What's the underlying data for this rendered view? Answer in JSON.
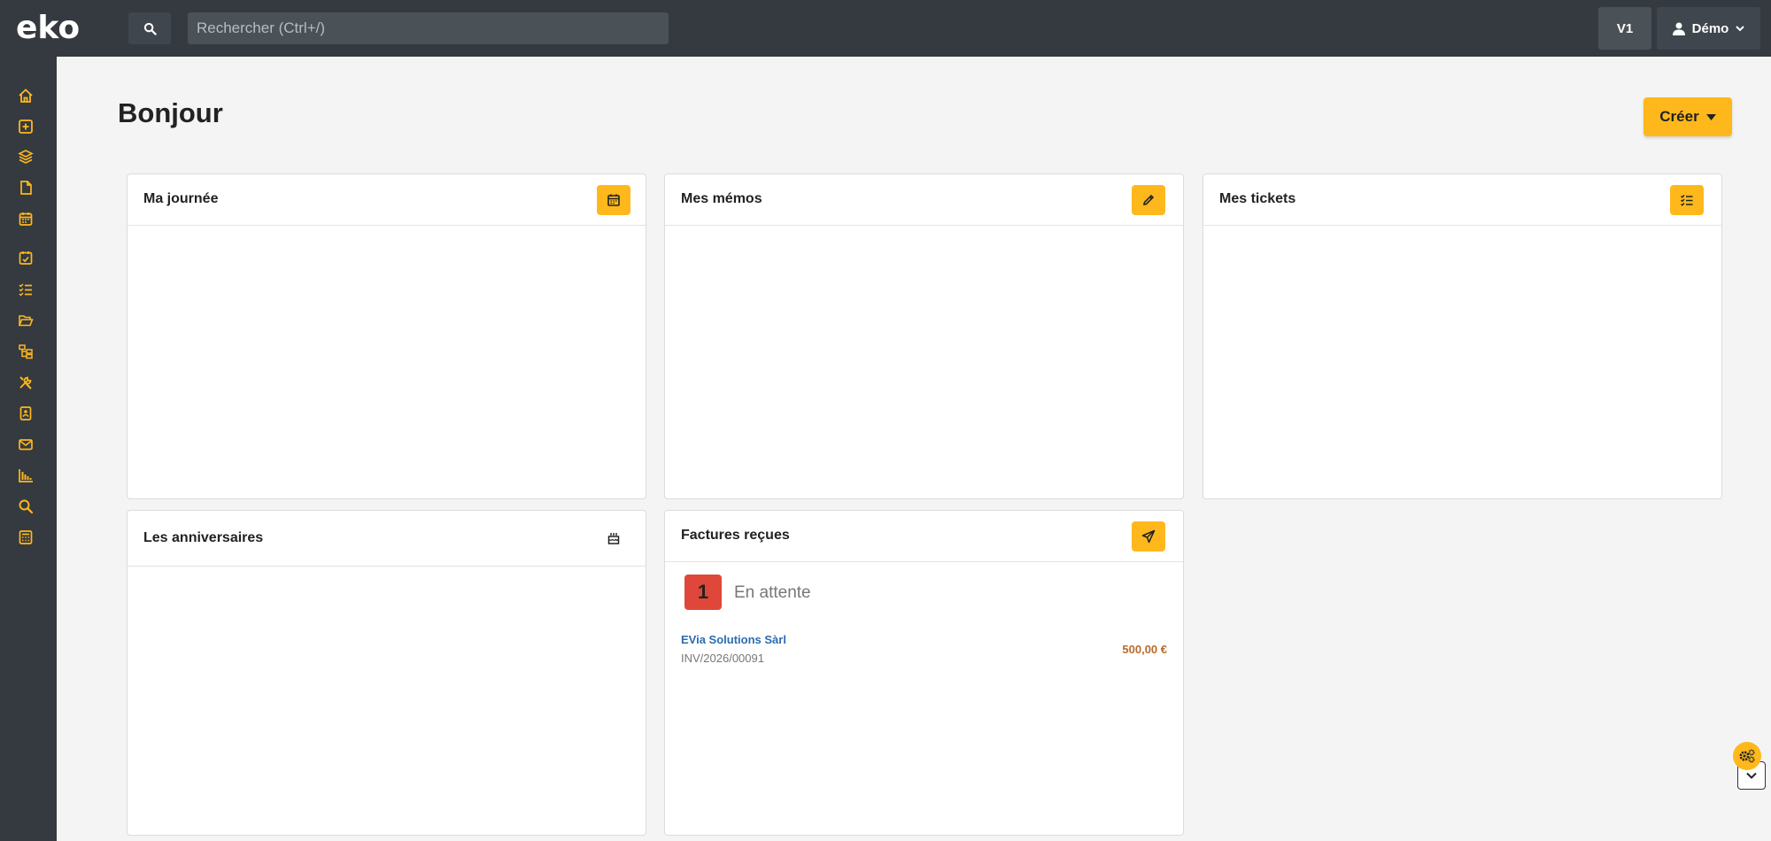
{
  "app": {
    "logo_text": "eko"
  },
  "topbar": {
    "search_placeholder": "Rechercher (Ctrl+/)",
    "version_label": "V1",
    "user_name": "Démo"
  },
  "sidebar": {
    "items": [
      {
        "icon": "home-icon"
      },
      {
        "icon": "plus-square-icon"
      },
      {
        "icon": "layers-icon"
      },
      {
        "icon": "file-icon"
      },
      {
        "icon": "calendar-icon"
      },
      {
        "icon": "calendar-check-icon"
      },
      {
        "icon": "task-list-icon"
      },
      {
        "icon": "folder-open-icon"
      },
      {
        "icon": "org-chart-icon"
      },
      {
        "icon": "tools-icon"
      },
      {
        "icon": "contact-book-icon"
      },
      {
        "icon": "mail-icon"
      },
      {
        "icon": "bar-chart-icon"
      },
      {
        "icon": "search-icon"
      },
      {
        "icon": "calculator-icon"
      }
    ],
    "accent": "#ffb81c"
  },
  "main": {
    "title": "Bonjour",
    "create_label": "Créer"
  },
  "cards": {
    "journee": {
      "title": "Ma journée"
    },
    "memos": {
      "title": "Mes mémos"
    },
    "tickets": {
      "title": "Mes tickets"
    },
    "anniversaires": {
      "title": "Les anniversaires"
    },
    "factures": {
      "title": "Factures reçues",
      "status_count": "1",
      "status_label": "En attente",
      "invoice": {
        "supplier": "EVia Solutions Sàrl",
        "reference": "INV/2026/00091",
        "amount": "500,00 €"
      }
    }
  },
  "colors": {
    "topbar": "#343a40",
    "accent": "#ffb81c",
    "danger": "#e0473b",
    "link": "#2b6cb0",
    "amount": "#b86b2c"
  }
}
